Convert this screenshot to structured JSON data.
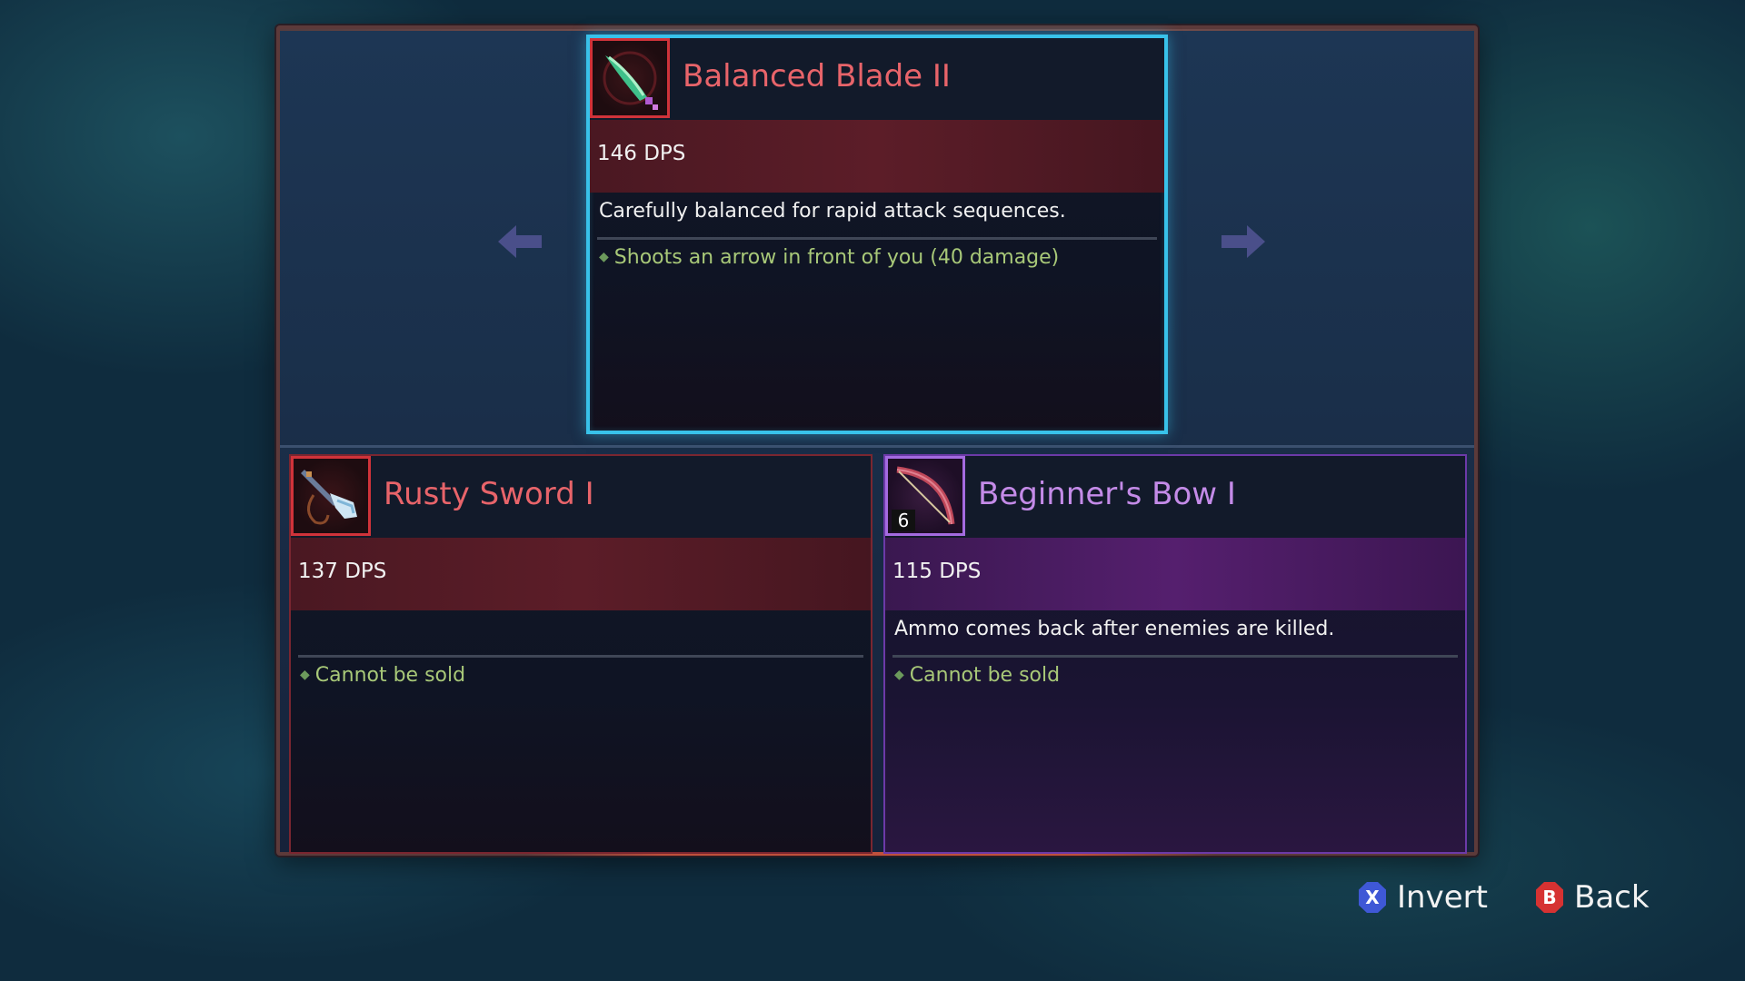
{
  "compare": {
    "selected": {
      "name": "Balanced Blade II",
      "dps": "146 DPS",
      "description": "Carefully balanced for rapid attack sequences.",
      "effect": "Shoots an arrow in front of you (40 damage)",
      "icon": "green-blade-icon",
      "border_color": "#38c2ea"
    },
    "left": {
      "name": "Rusty Sword I",
      "dps": "137 DPS",
      "description": "",
      "effect": "Cannot be sold",
      "icon": "rusty-sword-icon"
    },
    "right": {
      "name": "Beginner's Bow I",
      "dps": "115 DPS",
      "description": "Ammo comes back after enemies are killed.",
      "effect": "Cannot be sold",
      "ammo": "6",
      "icon": "bow-icon"
    }
  },
  "footer": {
    "invert": {
      "key": "X",
      "label": "Invert",
      "color": "#3f58d6"
    },
    "back": {
      "key": "B",
      "label": "Back",
      "color": "#d63232"
    }
  }
}
